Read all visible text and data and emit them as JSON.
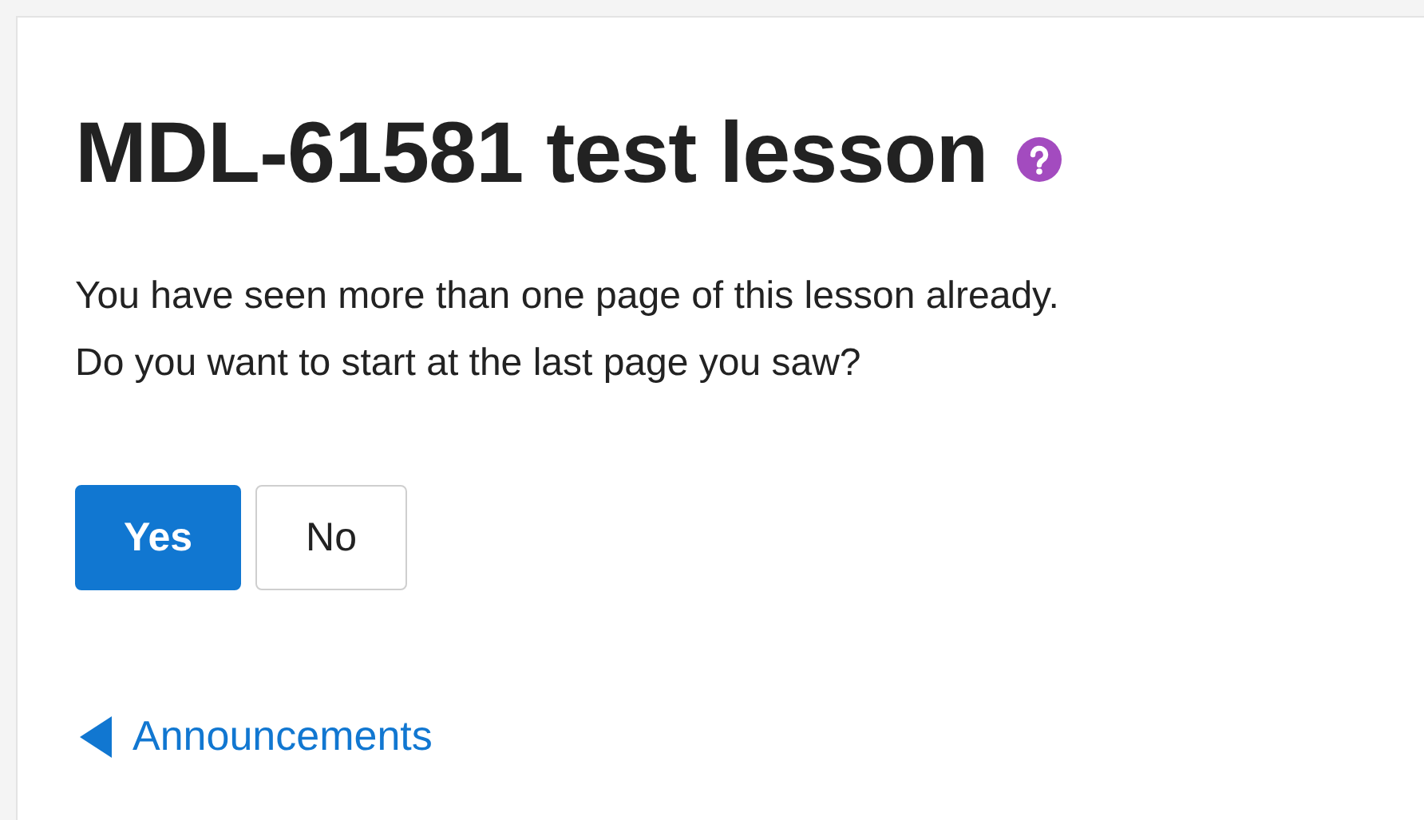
{
  "page": {
    "title": "MDL-61581 test lesson"
  },
  "message": [
    "You have seen more than one page of this lesson already.",
    "Do you want to start at the last page you saw?"
  ],
  "buttons": [
    {
      "label": "Yes",
      "kind": "primary"
    },
    {
      "label": "No",
      "kind": "secondary"
    }
  ],
  "back_link": {
    "label": "Announcements"
  }
}
